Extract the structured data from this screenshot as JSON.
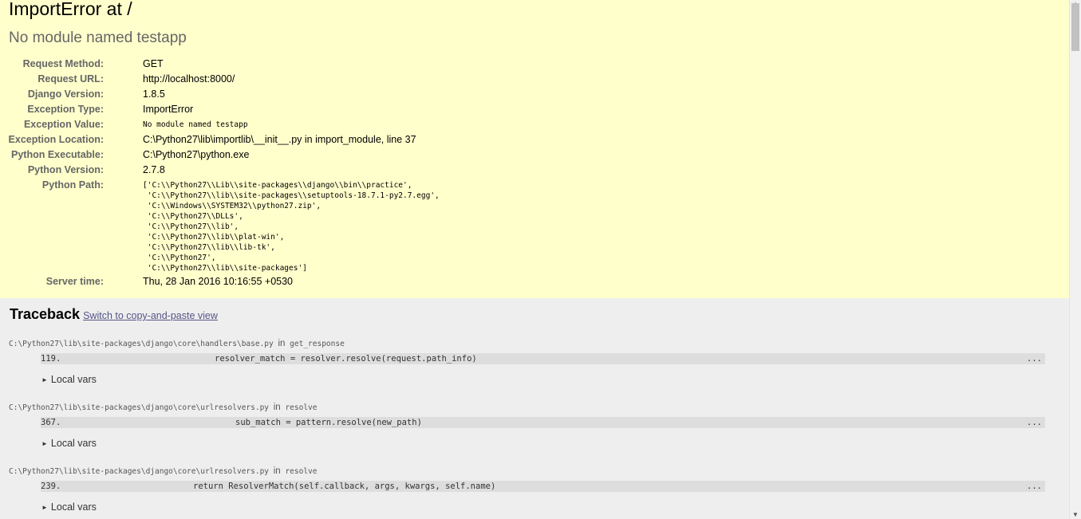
{
  "header": {
    "title": "ImportError at /",
    "subtitle": "No module named testapp"
  },
  "meta": [
    {
      "key": "Request Method:",
      "value": "GET"
    },
    {
      "key": "Request URL:",
      "value": "http://localhost:8000/"
    },
    {
      "key": "Django Version:",
      "value": "1.8.5"
    },
    {
      "key": "Exception Type:",
      "value": "ImportError"
    },
    {
      "key": "Exception Value:",
      "value": "No module named testapp"
    },
    {
      "key": "Exception Location:",
      "value": "C:\\Python27\\lib\\importlib\\__init__.py in import_module, line 37"
    },
    {
      "key": "Python Executable:",
      "value": "C:\\Python27\\python.exe"
    },
    {
      "key": "Python Version:",
      "value": "2.7.8"
    }
  ],
  "python_path": {
    "key": "Python Path:",
    "lines": [
      "['C:\\\\Python27\\\\Lib\\\\site-packages\\\\django\\\\bin\\\\practice',",
      " 'C:\\\\Python27\\\\lib\\\\site-packages\\\\setuptools-18.7.1-py2.7.egg',",
      " 'C:\\\\Windows\\\\SYSTEM32\\\\python27.zip',",
      " 'C:\\\\Python27\\\\DLLs',",
      " 'C:\\\\Python27\\\\lib',",
      " 'C:\\\\Python27\\\\lib\\\\plat-win',",
      " 'C:\\\\Python27\\\\lib\\\\lib-tk',",
      " 'C:\\\\Python27',",
      " 'C:\\\\Python27\\\\lib\\\\site-packages']"
    ]
  },
  "server_time": {
    "key": "Server time:",
    "value": "Thu, 28 Jan 2016 10:16:55 +0530"
  },
  "traceback": {
    "heading": "Traceback",
    "switch_link": "Switch to copy-and-paste view",
    "frames": [
      {
        "file": "C:\\Python27\\lib\\site-packages\\django\\core\\handlers\\base.py",
        "in_word": "in",
        "function": "get_response",
        "line_no": "119.",
        "code": "resolver_match = resolver.resolve(request.path_info)",
        "dots": "...",
        "local_vars": "Local vars"
      },
      {
        "file": "C:\\Python27\\lib\\site-packages\\django\\core\\urlresolvers.py",
        "in_word": "in",
        "function": "resolve",
        "line_no": "367.",
        "code": "sub_match = pattern.resolve(new_path)",
        "dots": "...",
        "local_vars": "Local vars"
      },
      {
        "file": "C:\\Python27\\lib\\site-packages\\django\\core\\urlresolvers.py",
        "in_word": "in",
        "function": "resolve",
        "line_no": "239.",
        "code": "return ResolverMatch(self.callback, args, kwargs, self.name)",
        "dots": "...",
        "local_vars": "Local vars"
      }
    ]
  },
  "icons": {
    "expand": "triangle-right-icon",
    "scroll_up": "arrow-up-icon",
    "scroll_down": "arrow-down-icon"
  }
}
